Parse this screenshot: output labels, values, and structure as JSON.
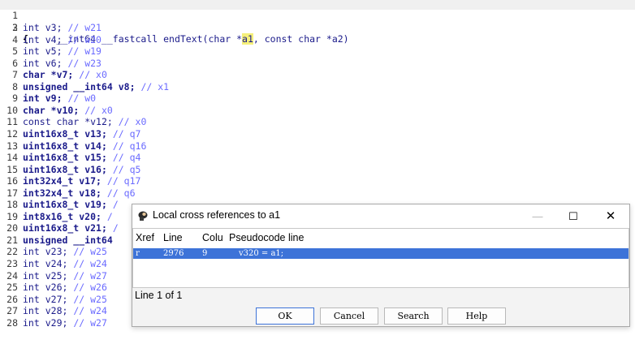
{
  "code": {
    "header": {
      "num": "1",
      "pre": "__int64 __fastcall endText(char *",
      "highlight": "a1",
      "post": ", const char *a2)"
    },
    "brace_line": {
      "num": "2",
      "text": "{"
    },
    "lines": [
      {
        "num": "3",
        "type": "int",
        "var": "v3;",
        "comment": "// w21",
        "bold": false
      },
      {
        "num": "4",
        "type": "int",
        "var": "v4;",
        "comment": "// w20",
        "bold": false
      },
      {
        "num": "5",
        "type": "int",
        "var": "v5;",
        "comment": "// w19",
        "bold": false
      },
      {
        "num": "6",
        "type": "int",
        "var": "v6;",
        "comment": "// w23",
        "bold": false
      },
      {
        "num": "7",
        "type": "char",
        "var": "*v7;",
        "comment": "// x0",
        "bold": true
      },
      {
        "num": "8",
        "type": "unsigned __int64",
        "var": "v8;",
        "comment": "// x1",
        "bold": true
      },
      {
        "num": "9",
        "type": "int",
        "var": "v9;",
        "comment": "// w0",
        "bold": true
      },
      {
        "num": "10",
        "type": "char",
        "var": "*v10;",
        "comment": "// x0",
        "bold": true
      },
      {
        "num": "11",
        "type": "const char",
        "var": "*v12;",
        "comment": "// x0",
        "bold": false
      },
      {
        "num": "12",
        "type": "uint16x8_t",
        "var": "v13;",
        "comment": "// q7",
        "bold": true
      },
      {
        "num": "13",
        "type": "uint16x8_t",
        "var": "v14;",
        "comment": "// q16",
        "bold": true
      },
      {
        "num": "14",
        "type": "uint16x8_t",
        "var": "v15;",
        "comment": "// q4",
        "bold": true
      },
      {
        "num": "15",
        "type": "uint16x8_t",
        "var": "v16;",
        "comment": "// q5",
        "bold": true
      },
      {
        "num": "16",
        "type": "int32x4_t",
        "var": "v17;",
        "comment": "// q17",
        "bold": true
      },
      {
        "num": "17",
        "type": "int32x4_t",
        "var": "v18;",
        "comment": "// q6",
        "bold": true
      },
      {
        "num": "18",
        "type": "uint16x8_t",
        "var": "v19;",
        "comment": "/",
        "bold": true
      },
      {
        "num": "19",
        "type": "int8x16_t",
        "var": "v20;",
        "comment": "/",
        "bold": true
      },
      {
        "num": "20",
        "type": "uint16x8_t",
        "var": "v21;",
        "comment": "/",
        "bold": true
      },
      {
        "num": "21",
        "type": "unsigned __int64",
        "var": "",
        "comment": "",
        "bold": true
      },
      {
        "num": "22",
        "type": "int",
        "var": "v23;",
        "comment": "// w25",
        "bold": false
      },
      {
        "num": "23",
        "type": "int",
        "var": "v24;",
        "comment": "// w24",
        "bold": false
      },
      {
        "num": "24",
        "type": "int",
        "var": "v25;",
        "comment": "// w27",
        "bold": false
      },
      {
        "num": "25",
        "type": "int",
        "var": "v26;",
        "comment": "// w26",
        "bold": false
      },
      {
        "num": "26",
        "type": "int",
        "var": "v27;",
        "comment": "// w25",
        "bold": false
      },
      {
        "num": "27",
        "type": "int",
        "var": "v28;",
        "comment": "// w24",
        "bold": false
      },
      {
        "num": "28",
        "type": "int",
        "var": "v29;",
        "comment": "// w27",
        "bold": false
      }
    ]
  },
  "dialog": {
    "title": "Local cross references to a1",
    "title_icon": "ida-icon",
    "window_controls": {
      "minimize": "—",
      "maximize": "☐",
      "close": "✕"
    },
    "columns": [
      "Xref",
      "Line",
      "Colu",
      "Pseudocode line"
    ],
    "rows": [
      {
        "xref": "r",
        "line": "2976",
        "column": "9",
        "pseudocode": "v320 = a1;"
      }
    ],
    "status": "Line 1 of 1",
    "buttons": {
      "ok": "OK",
      "cancel": "Cancel",
      "search": "Search",
      "help": "Help"
    },
    "selection_color": "#3d73d8"
  }
}
